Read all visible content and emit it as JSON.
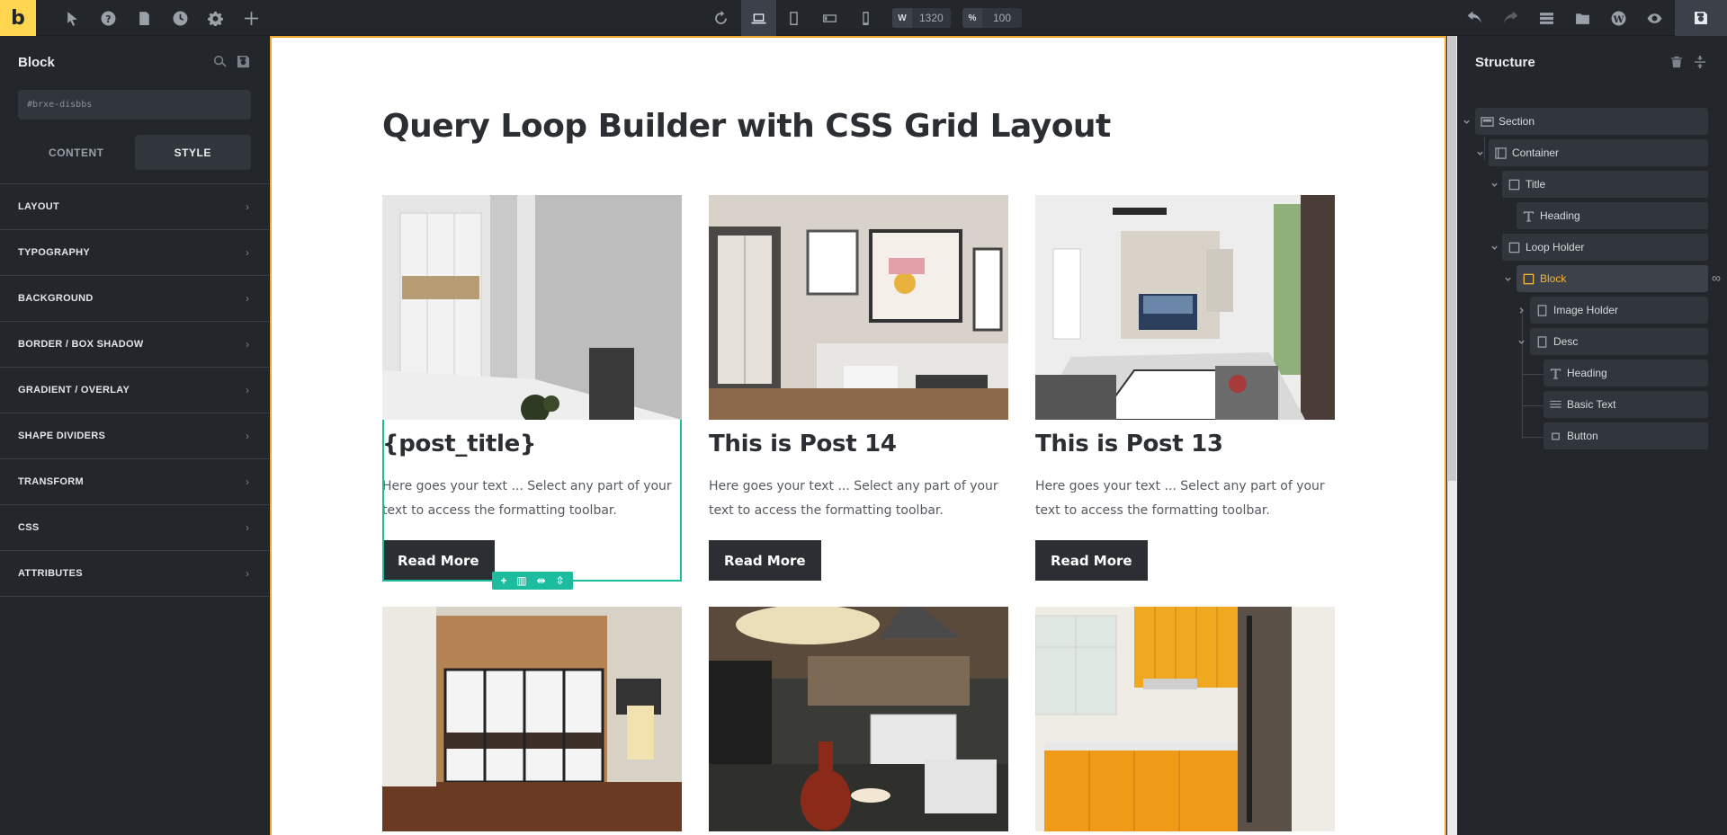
{
  "topbar": {
    "logo": "b",
    "width_label": "W",
    "width_value": "1320",
    "zoom_label": "%",
    "zoom_value": "100"
  },
  "left_panel": {
    "title": "Block",
    "css_id_placeholder": "#brxe-disbbs",
    "tabs": [
      {
        "label": "CONTENT",
        "active": false
      },
      {
        "label": "STYLE",
        "active": true
      }
    ],
    "sections": [
      {
        "label": "LAYOUT"
      },
      {
        "label": "TYPOGRAPHY"
      },
      {
        "label": "BACKGROUND"
      },
      {
        "label": "BORDER / BOX SHADOW"
      },
      {
        "label": "GRADIENT / OVERLAY"
      },
      {
        "label": "SHAPE DIVIDERS"
      },
      {
        "label": "TRANSFORM"
      },
      {
        "label": "CSS"
      },
      {
        "label": "ATTRIBUTES"
      }
    ]
  },
  "canvas": {
    "page_title": "Query Loop Builder with CSS Grid Layout",
    "cards": [
      {
        "title": "{post_title}",
        "text": "Here goes your text ... Select any part of your text to access the formatting toolbar.",
        "button": "Read More"
      },
      {
        "title": "This is Post 14",
        "text": "Here goes your text ... Select any part of your text to access the formatting toolbar.",
        "button": "Read More"
      },
      {
        "title": "This is Post 13",
        "text": "Here goes your text ... Select any part of your text to access the formatting toolbar.",
        "button": "Read More"
      }
    ],
    "selection_toolbar": [
      "+",
      "▥",
      "⇹",
      "⇳"
    ]
  },
  "structure": {
    "title": "Structure",
    "items": [
      {
        "label": "Section",
        "icon": "section-icon"
      },
      {
        "label": "Container",
        "icon": "container-icon"
      },
      {
        "label": "Title",
        "icon": "div-icon"
      },
      {
        "label": "Heading",
        "icon": "heading-icon"
      },
      {
        "label": "Loop Holder",
        "icon": "div-icon"
      },
      {
        "label": "Block",
        "icon": "block-icon",
        "selected": true
      },
      {
        "label": "Image Holder",
        "icon": "div-icon"
      },
      {
        "label": "Desc",
        "icon": "div-icon"
      },
      {
        "label": "Heading",
        "icon": "heading-icon"
      },
      {
        "label": "Basic Text",
        "icon": "text-icon"
      },
      {
        "label": "Button",
        "icon": "button-icon"
      }
    ]
  },
  "colors": {
    "accent": "#ffd64f",
    "selection": "#1ebc9e",
    "canvas_border": "#f0a830",
    "selected_label": "#f3b43a",
    "panel_bg": "#23262b"
  }
}
